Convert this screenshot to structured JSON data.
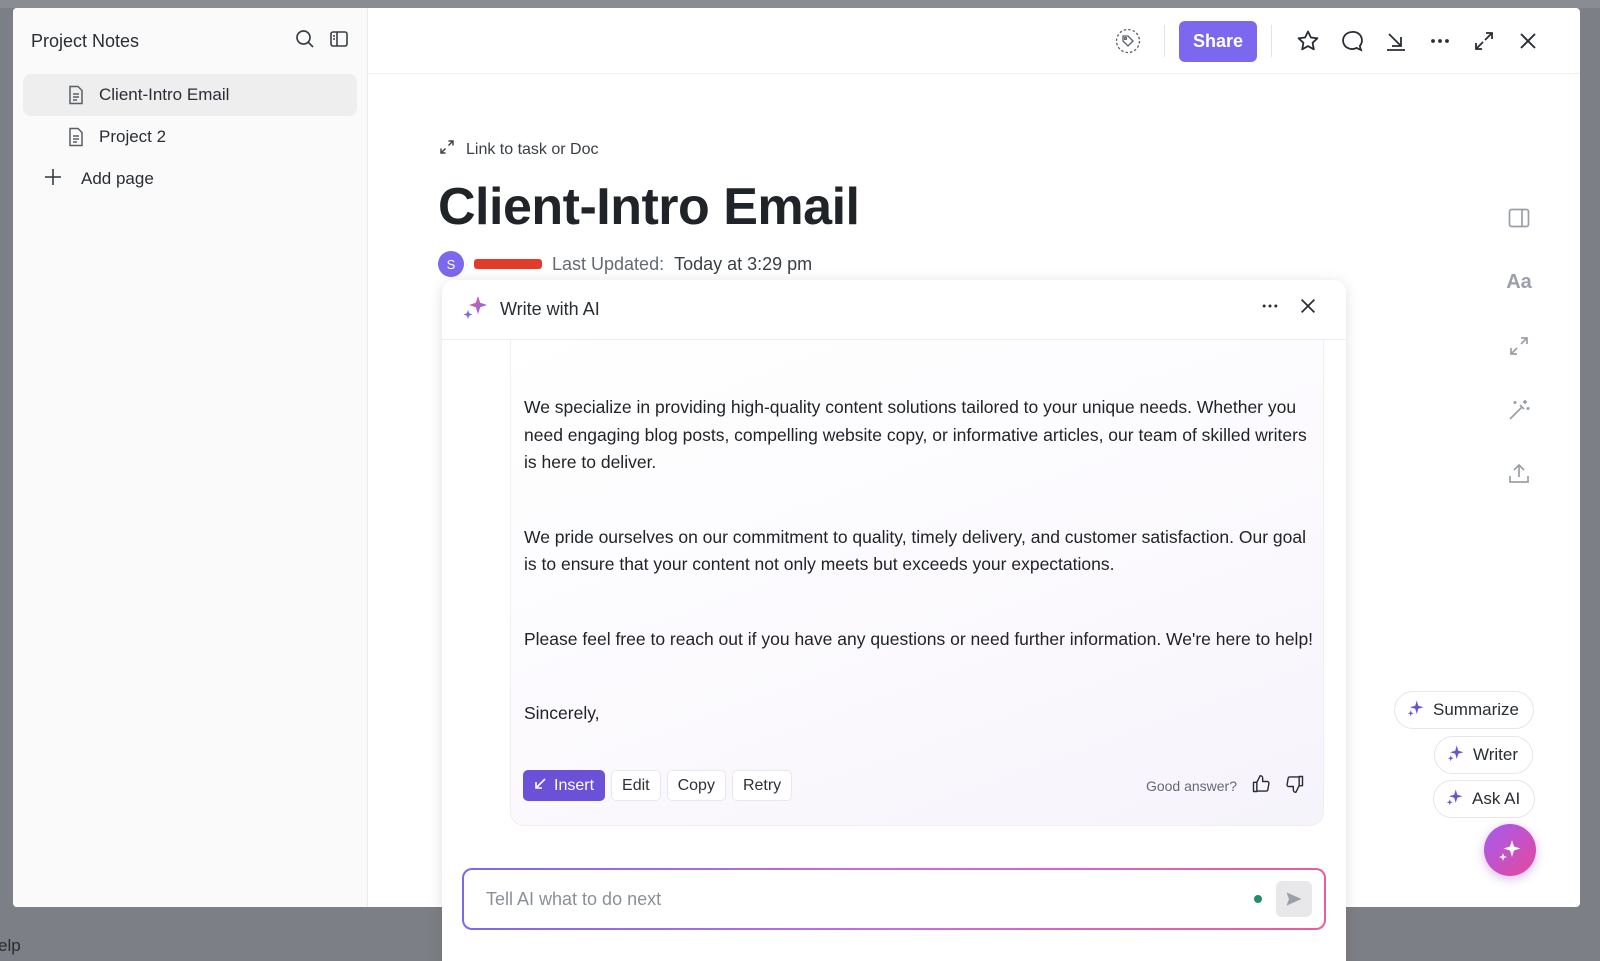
{
  "background": {
    "help_text": "elp"
  },
  "sidebar": {
    "title": "Project Notes",
    "items": [
      {
        "label": "Client-Intro Email",
        "active": true
      },
      {
        "label": "Project 2",
        "active": false
      }
    ],
    "add_page_label": "Add page"
  },
  "topbar": {
    "share_label": "Share"
  },
  "doc": {
    "link_label": "Link to task or Doc",
    "title": "Client-Intro Email",
    "avatar_initial": "S",
    "last_updated_label": "Last Updated:",
    "last_updated_value": "Today at 3:29 pm"
  },
  "right_rail": {
    "font_label": "Aa"
  },
  "ai_panel": {
    "title": "Write with AI",
    "paragraphs": [
      "We specialize in providing high-quality content solutions tailored to your unique needs. Whether you need engaging blog posts, compelling website copy, or informative articles, our team of skilled writers is here to deliver.",
      "We pride ourselves on our commitment to quality, timely delivery, and customer satisfaction. Our goal is to ensure that your content not only meets but exceeds your expectations.",
      "Please feel free to reach out if you have any questions or need further information. We're here to help!",
      "Sincerely,"
    ],
    "actions": {
      "insert": "Insert",
      "edit": "Edit",
      "copy": "Copy",
      "retry": "Retry"
    },
    "feedback_label": "Good answer?",
    "input_placeholder": "Tell AI what to do next"
  },
  "quick_actions": {
    "summarize": "Summarize",
    "writer": "Writer",
    "ask_ai": "Ask AI"
  },
  "colors": {
    "accent": "#7b68ee",
    "insert_button": "#6b50d8",
    "redaction": "#e23b2a"
  }
}
